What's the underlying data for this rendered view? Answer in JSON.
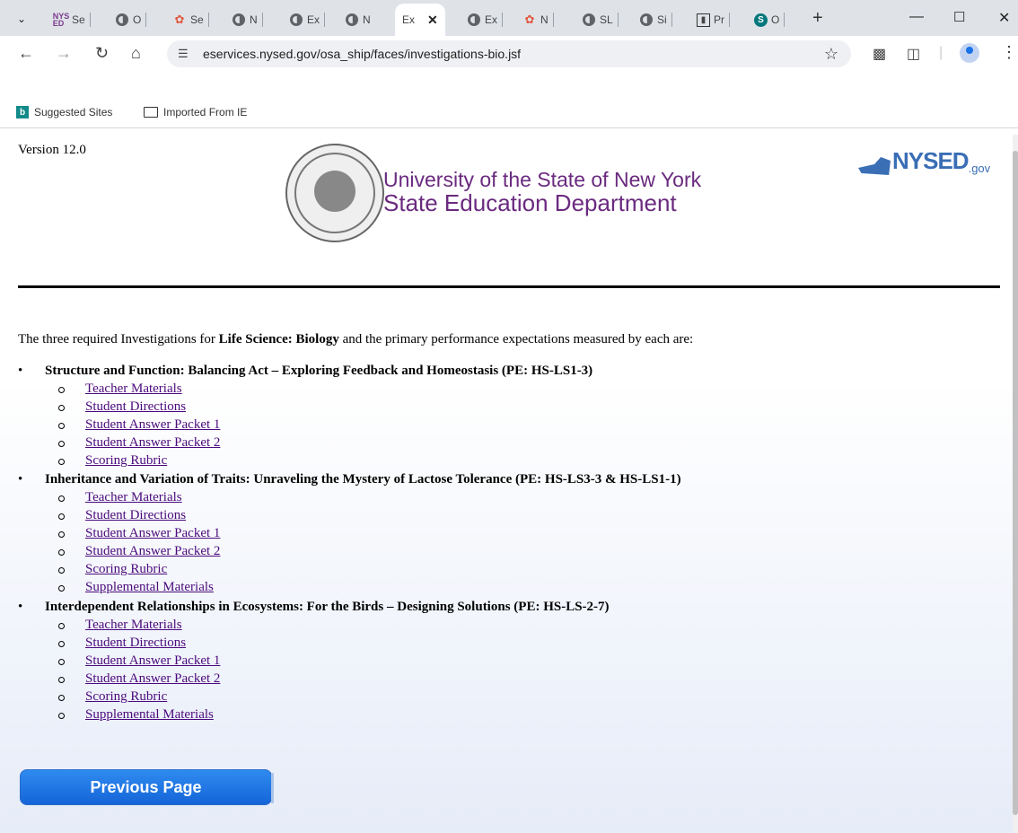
{
  "browser": {
    "tabs": [
      {
        "label": "Se",
        "icon": "nysed-favicon"
      },
      {
        "label": "O",
        "icon": "globe"
      },
      {
        "label": "Se",
        "icon": "flower"
      },
      {
        "label": "N",
        "icon": "globe"
      },
      {
        "label": "Ex",
        "icon": "globe"
      },
      {
        "label": "N",
        "icon": "globe"
      },
      {
        "label": "Ex",
        "icon": "none",
        "active": true
      },
      {
        "label": "Ex",
        "icon": "globe"
      },
      {
        "label": "N",
        "icon": "flower"
      },
      {
        "label": "SL",
        "icon": "globe"
      },
      {
        "label": "Si",
        "icon": "globe"
      },
      {
        "label": "Pr",
        "icon": "chart"
      },
      {
        "label": "O",
        "icon": "sharepoint"
      }
    ],
    "url": "eservices.nysed.gov/osa_ship/faces/investigations-bio.jsf",
    "bookmarks": [
      "Suggested Sites",
      "Imported From IE"
    ]
  },
  "page": {
    "version": "Version 12.0",
    "org_line1": "University of the State of New York",
    "org_line2": "State Education Department",
    "logo_text": "NYSED",
    "logo_suffix": ".gov",
    "intro_pre": "The three required Investigations for ",
    "intro_bold": "Life Science: Biology",
    "intro_post": " and the primary performance expectations measured by each are:",
    "investigations": [
      {
        "title": "Structure and Function: Balancing Act – Exploring Feedback and Homeostasis (PE: HS-LS1-3)",
        "links": [
          "Teacher Materials",
          "Student Directions",
          "Student Answer Packet 1",
          "Student Answer Packet 2",
          "Scoring Rubric"
        ]
      },
      {
        "title": "Inheritance and Variation of Traits: Unraveling the Mystery of Lactose Tolerance (PE: HS-LS3-3 & HS-LS1-1)",
        "links": [
          "Teacher Materials",
          "Student Directions",
          "Student Answer Packet 1",
          "Student Answer Packet 2",
          "Scoring Rubric",
          "Supplemental Materials"
        ]
      },
      {
        "title": "Interdependent Relationships in Ecosystems: For the Birds – Designing Solutions (PE: HS-LS-2-7)",
        "links": [
          "Teacher Materials",
          "Student Directions",
          "Student Answer Packet 1",
          "Student Answer Packet 2",
          "Scoring Rubric",
          "Supplemental Materials"
        ]
      }
    ],
    "prev_button": "Previous Page"
  }
}
